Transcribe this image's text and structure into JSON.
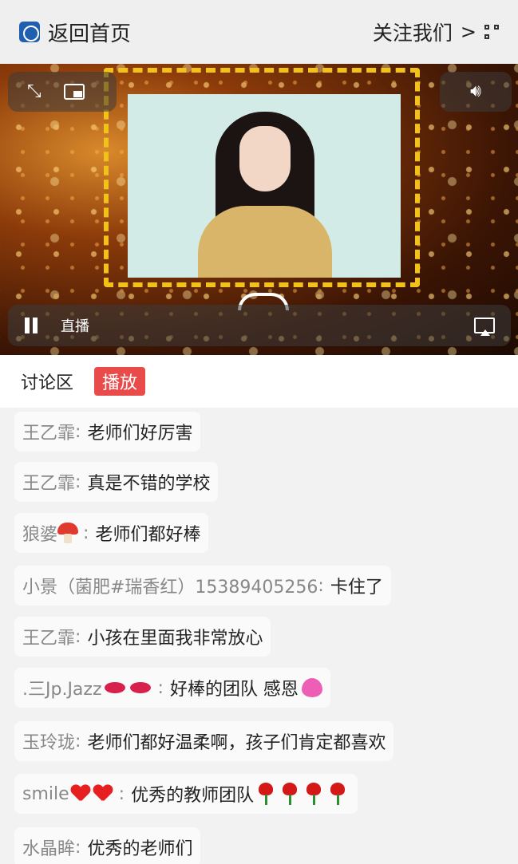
{
  "header": {
    "back_label": "返回首页",
    "follow_label": "关注我们",
    "follow_chevron": ">"
  },
  "player": {
    "status_label": "直播"
  },
  "tabs": {
    "discussion": "讨论区",
    "playback": "播放"
  },
  "messages": [
    {
      "user": "王乙霏",
      "text": "老师们好厉害"
    },
    {
      "user": "王乙霏",
      "text": "真是不错的学校"
    },
    {
      "user": "狼婆",
      "text": "老师们都好棒"
    },
    {
      "user": "小景（菌肥#瑞香红）15389405256",
      "text": "卡住了"
    },
    {
      "user": "王乙霏",
      "text": "小孩在里面我非常放心"
    },
    {
      "user": ".三Jp.Jazz",
      "text": "好棒的团队 感恩"
    },
    {
      "user": "玉玲珑",
      "text": "老师们都好温柔啊，孩子们肯定都喜欢"
    },
    {
      "user": "smile",
      "text": "优秀的教师团队"
    },
    {
      "user": "水晶眸",
      "text": "优秀的老师们"
    }
  ],
  "separator": ":",
  "colors": {
    "accent_red": "#e94a4a",
    "frame_yellow": "#f2c21a"
  }
}
